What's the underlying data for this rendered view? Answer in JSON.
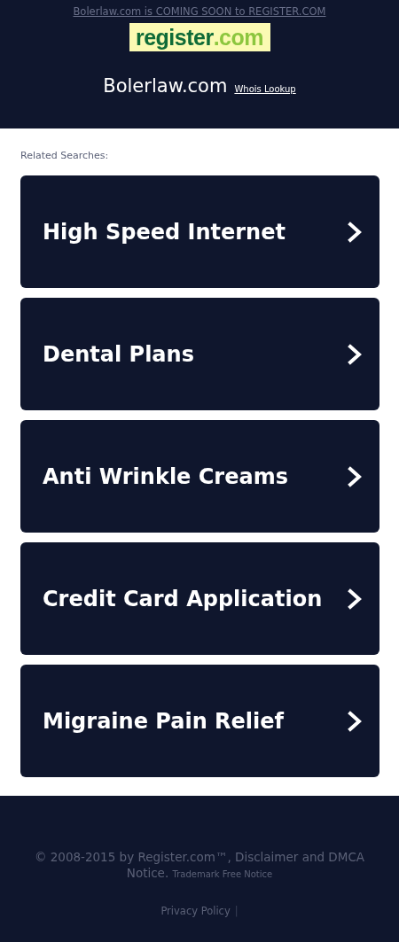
{
  "header": {
    "notice": "Bolerlaw.com is COMING SOON to REGISTER.COM",
    "logo": {
      "name": "register",
      "tld": ".com"
    },
    "domain": "Bolerlaw.com",
    "whois_link": "Whois Lookup"
  },
  "related": {
    "heading": "Related Searches:",
    "items": [
      {
        "label": "High Speed Internet"
      },
      {
        "label": "Dental Plans"
      },
      {
        "label": "Anti Wrinkle Creams"
      },
      {
        "label": "Credit Card Application"
      },
      {
        "label": "Migraine Pain Relief"
      }
    ]
  },
  "footer": {
    "copyright": "© 2008-2015 by Register.com™, Disclaimer and DMCA Notice.",
    "trademark_link": "Trademark Free Notice",
    "privacy_link": "Privacy Policy",
    "separator": "|"
  }
}
